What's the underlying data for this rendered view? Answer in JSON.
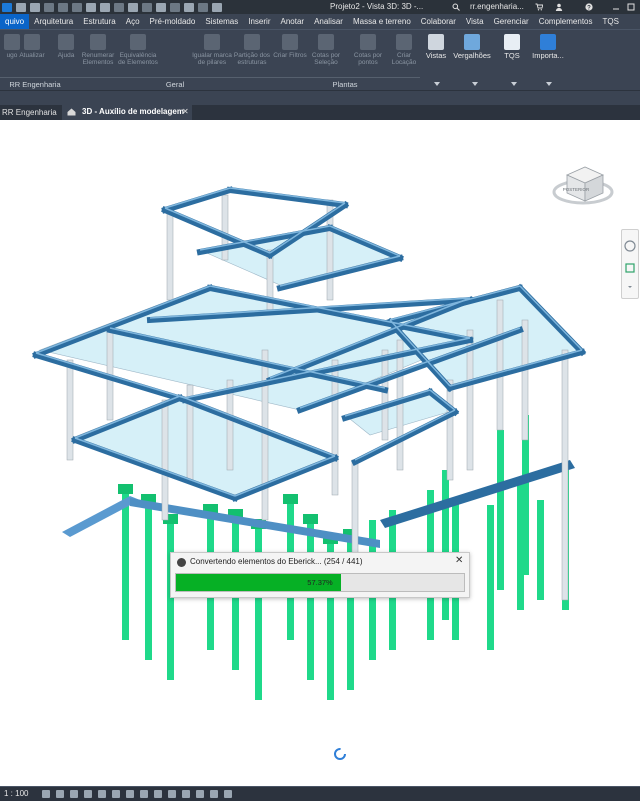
{
  "app": {
    "window_title": "Projeto2 - Vista 3D: 3D -...",
    "user": "rr.engenharia..."
  },
  "ribbon_tabs": [
    "quivo",
    "Arquitetura",
    "Estrutura",
    "Aço",
    "Pré-moldado",
    "Sistemas",
    "Inserir",
    "Anotar",
    "Analisar",
    "Massa e terreno",
    "Colaborar",
    "Vista",
    "Gerenciar",
    "Complementos",
    "TQS"
  ],
  "active_tab_index": 0,
  "ribbon": {
    "buttons": [
      {
        "label": "ugo",
        "icon": "plugin-icon",
        "enabled": false
      },
      {
        "label": "Atualizar",
        "icon": "refresh-icon",
        "enabled": false
      },
      {
        "label": "Ajuda",
        "icon": "help-icon",
        "enabled": false
      },
      {
        "label": "Renumerar Elementos",
        "icon": "v1-icon",
        "enabled": false
      },
      {
        "label": "Equivalência de Elementos",
        "icon": "equivalence-icon",
        "enabled": false
      },
      {
        "label": "Igualar marca de pilares",
        "icon": "pillar-mark-icon",
        "enabled": false
      },
      {
        "label": "Partição dos estruturas",
        "icon": "partition-icon",
        "enabled": false
      },
      {
        "label": "Criar Filtros",
        "icon": "filter-icon",
        "enabled": false
      },
      {
        "label": "Cotas por Seleção",
        "icon": "dimension-icon",
        "enabled": false
      },
      {
        "label": "Cotas por pontos",
        "icon": "dimension-points-icon",
        "enabled": false
      },
      {
        "label": "Criar Locação",
        "icon": "location-icon",
        "enabled": false
      },
      {
        "label": "Vistas",
        "icon": "views-icon",
        "enabled": true
      },
      {
        "label": "Vergalhões",
        "icon": "rebar-icon",
        "enabled": true
      },
      {
        "label": "TQS",
        "icon": "tqs-icon",
        "enabled": true
      },
      {
        "label": "Importa...",
        "icon": "import-icon",
        "enabled": true
      }
    ],
    "panels": [
      {
        "label": "RR Engenharia"
      },
      {
        "label": "Geral"
      },
      {
        "label": "Plantas"
      }
    ]
  },
  "view_tabs": {
    "project_tab": "RR Engenharia",
    "active_view": "3D - Auxílio de modelagem"
  },
  "progress_dialog": {
    "title": "Convertendo elementos do Eberick... (254 / 441)",
    "percent_label": "57.37%",
    "progress": 0.5737,
    "close_icon": "close-icon"
  },
  "viewcube": {
    "face_label": "POSTERIOR"
  },
  "status_bar": {
    "scale": "1 : 100"
  },
  "colors": {
    "ribbon_bg": "#3b4453",
    "active_tab": "#0a64c8",
    "progress_fill": "#06b025",
    "beam": "#2c6da0",
    "slab": "#d6f0f8",
    "column": "#dde3e8",
    "foundation": "#1fd98a"
  }
}
